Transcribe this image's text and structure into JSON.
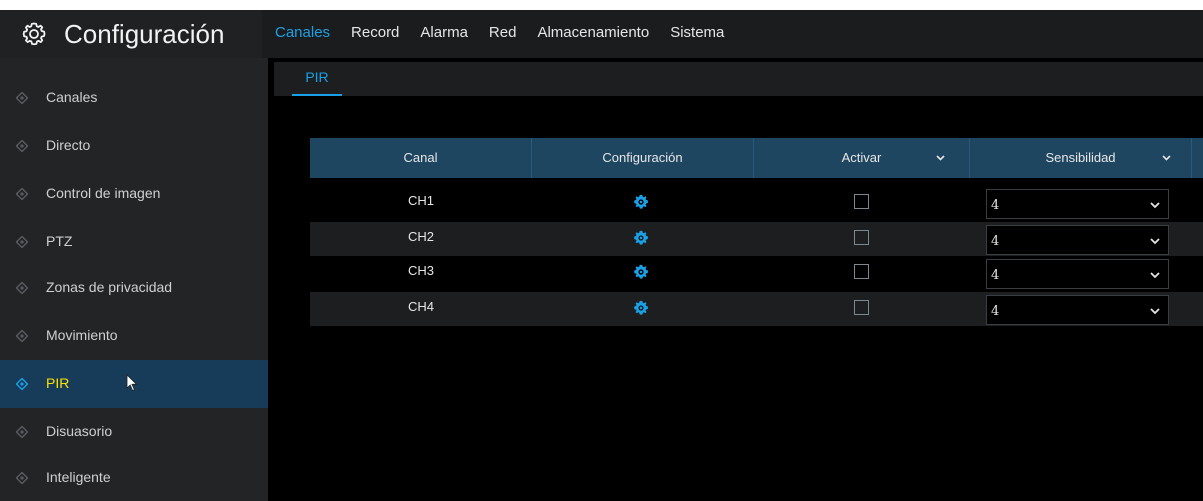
{
  "header": {
    "title": "Configuración",
    "icon": "gear-icon",
    "tabs": [
      {
        "label": "Canales",
        "active": true
      },
      {
        "label": "Record",
        "active": false
      },
      {
        "label": "Alarma",
        "active": false
      },
      {
        "label": "Red",
        "active": false
      },
      {
        "label": "Almacenamiento",
        "active": false
      },
      {
        "label": "Sistema",
        "active": false
      }
    ]
  },
  "sidebar": {
    "items": [
      {
        "label": "Canales",
        "active": false
      },
      {
        "label": "Directo",
        "active": false
      },
      {
        "label": "Control de imagen",
        "active": false
      },
      {
        "label": "PTZ",
        "active": false
      },
      {
        "label": "Zonas de privacidad",
        "active": false
      },
      {
        "label": "Movimiento",
        "active": false
      },
      {
        "label": "PIR",
        "active": true
      },
      {
        "label": "Disuasorio",
        "active": false
      },
      {
        "label": "Inteligente",
        "active": false
      }
    ]
  },
  "subtab": {
    "label": "PIR"
  },
  "table": {
    "columns": [
      "Canal",
      "Configuración",
      "Activar",
      "Sensibilidad"
    ],
    "rows": [
      {
        "channel": "CH1",
        "activar": false,
        "sensibilidad": "4"
      },
      {
        "channel": "CH2",
        "activar": false,
        "sensibilidad": "4"
      },
      {
        "channel": "CH3",
        "activar": false,
        "sensibilidad": "4"
      },
      {
        "channel": "CH4",
        "activar": false,
        "sensibilidad": "4"
      }
    ]
  },
  "colors": {
    "accent": "#1aa0e6",
    "active_label": "#ffe000",
    "header_bg": "#1f4661",
    "active_sidebar_bg": "#173c5a"
  }
}
